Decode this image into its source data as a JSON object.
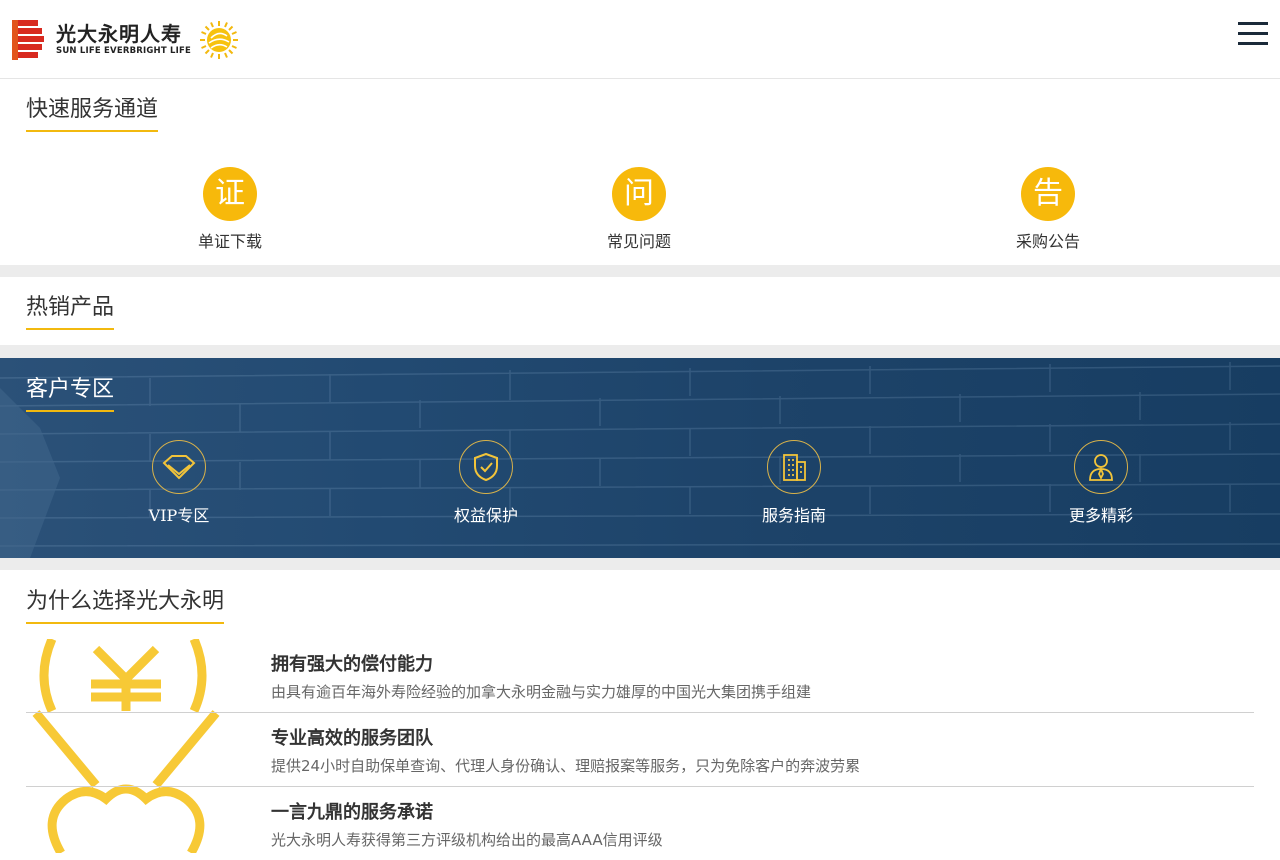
{
  "header": {
    "logo_cn": "光大永明人寿",
    "logo_en": "SUN LIFE EVERBRIGHT LIFE"
  },
  "quick": {
    "title": "快速服务通道",
    "items": [
      {
        "glyph": "证",
        "label": "单证下载"
      },
      {
        "glyph": "问",
        "label": "常见问题"
      },
      {
        "glyph": "告",
        "label": "采购公告"
      }
    ]
  },
  "hot": {
    "title": "热销产品"
  },
  "customer": {
    "title": "客户专区",
    "items": [
      {
        "icon": "diamond-icon",
        "label": "VIP专区"
      },
      {
        "icon": "shield-check-icon",
        "label": "权益保护"
      },
      {
        "icon": "building-icon",
        "label": "服务指南"
      },
      {
        "icon": "person-icon",
        "label": "更多精彩"
      }
    ]
  },
  "why": {
    "title": "为什么选择光大永明",
    "items": [
      {
        "title": "拥有强大的偿付能力",
        "desc": "由具有逾百年海外寿险经验的加拿大永明金融与实力雄厚的中国光大集团携手组建"
      },
      {
        "title": "专业高效的服务团队",
        "desc": "提供24小时自助保单查询、代理人身份确认、理赔报案等服务，只为免除客户的奔波劳累"
      },
      {
        "title": "一言九鼎的服务承诺",
        "desc": "光大永明人寿获得第三方评级机构给出的最高AAA信用评级"
      }
    ]
  },
  "colors": {
    "accent": "#f7b90b",
    "brand_red": "#d82a20",
    "blue_panel": "#1f466d"
  }
}
